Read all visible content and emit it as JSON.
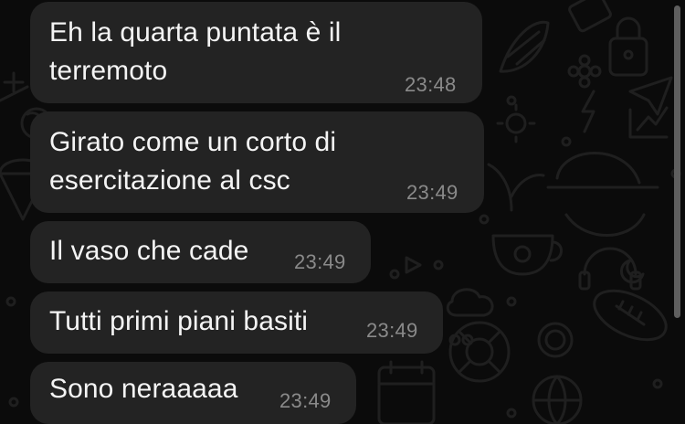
{
  "chat": {
    "background_color": "#0b0b0b",
    "bubble_color": "#232323",
    "text_color": "#f4f4f4",
    "time_color": "#8a8a8a",
    "wallpaper_icons": [
      "tablet-icon",
      "lock-icon",
      "corn-icon",
      "flower-icon",
      "chart-icon",
      "lightning-icon",
      "sun-icon",
      "lollipop-icon",
      "ice-cream-icon",
      "cap-icon",
      "plant-icon",
      "teacup-icon",
      "headphones-icon",
      "moon-icon",
      "football-icon",
      "ring-buoy-icon",
      "coin-icon",
      "basketball-icon",
      "cloud-icon",
      "calendar-icon"
    ],
    "messages": [
      {
        "text": "Eh la quarta puntata è il\nterremoto",
        "time": "23:48"
      },
      {
        "text": "Girato come un corto di\nesercitazione al csc",
        "time": "23:49"
      },
      {
        "text": "Il vaso che cade",
        "time": "23:49"
      },
      {
        "text": "Tutti primi piani basiti",
        "time": "23:49"
      },
      {
        "text": "Sono neraaaaa",
        "time": "23:49"
      }
    ]
  }
}
